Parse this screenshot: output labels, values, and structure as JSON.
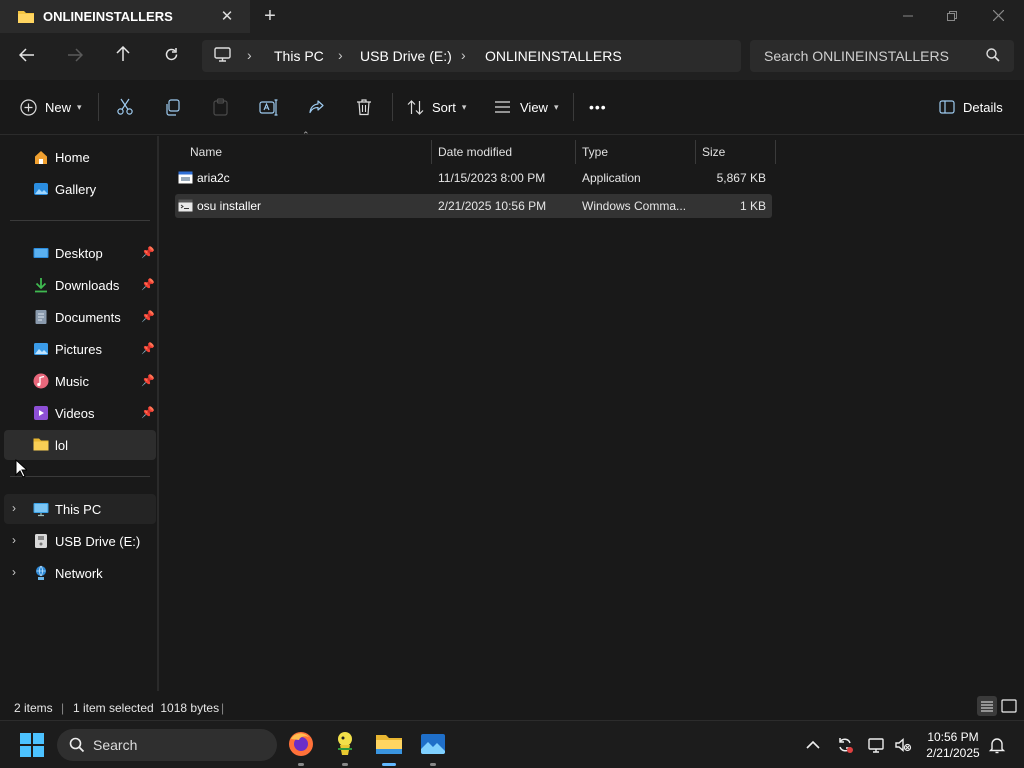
{
  "window": {
    "tab_title": "ONLINEINSTALLERS",
    "tab_close": "✕",
    "new_tab": "+"
  },
  "breadcrumb": [
    "This PC",
    "USB Drive (E:)",
    "ONLINEINSTALLERS"
  ],
  "search": {
    "placeholder": "Search ONLINEINSTALLERS"
  },
  "toolbar": {
    "new_label": "New",
    "sort_label": "Sort",
    "view_label": "View",
    "details_label": "Details",
    "more": "•••"
  },
  "sidebar": {
    "top": [
      {
        "label": "Home",
        "icon": "home-icon"
      },
      {
        "label": "Gallery",
        "icon": "gallery-icon"
      }
    ],
    "quick": [
      {
        "label": "Desktop",
        "icon": "desktop-icon",
        "pinned": true
      },
      {
        "label": "Downloads",
        "icon": "downloads-icon",
        "pinned": true
      },
      {
        "label": "Documents",
        "icon": "documents-icon",
        "pinned": true
      },
      {
        "label": "Pictures",
        "icon": "pictures-icon",
        "pinned": true
      },
      {
        "label": "Music",
        "icon": "music-icon",
        "pinned": true
      },
      {
        "label": "Videos",
        "icon": "videos-icon",
        "pinned": true
      },
      {
        "label": "lol",
        "icon": "folder-icon",
        "pinned": false
      }
    ],
    "drives": [
      {
        "label": "This PC",
        "icon": "this-pc-icon"
      },
      {
        "label": "USB Drive (E:)",
        "icon": "usb-drive-icon"
      },
      {
        "label": "Network",
        "icon": "network-icon"
      }
    ]
  },
  "columns": [
    "Name",
    "Date modified",
    "Type",
    "Size"
  ],
  "files": [
    {
      "name": "aria2c",
      "date": "11/15/2023 8:00 PM",
      "type": "Application",
      "size": "5,867 KB",
      "icon": "application-icon",
      "selected": false
    },
    {
      "name": "osu installer",
      "date": "2/21/2025 10:56 PM",
      "type": "Windows Comma...",
      "size": "1 KB",
      "icon": "cmd-script-icon",
      "selected": true
    }
  ],
  "status": {
    "items": "2 items",
    "selected": "1 item selected  1018 bytes"
  },
  "taskbar": {
    "search_label": "Search",
    "time": "10:56 PM",
    "date": "2/21/2025"
  },
  "colors": {
    "accent": "#0078d4",
    "folder": "#f4c542",
    "background": "#191919"
  }
}
